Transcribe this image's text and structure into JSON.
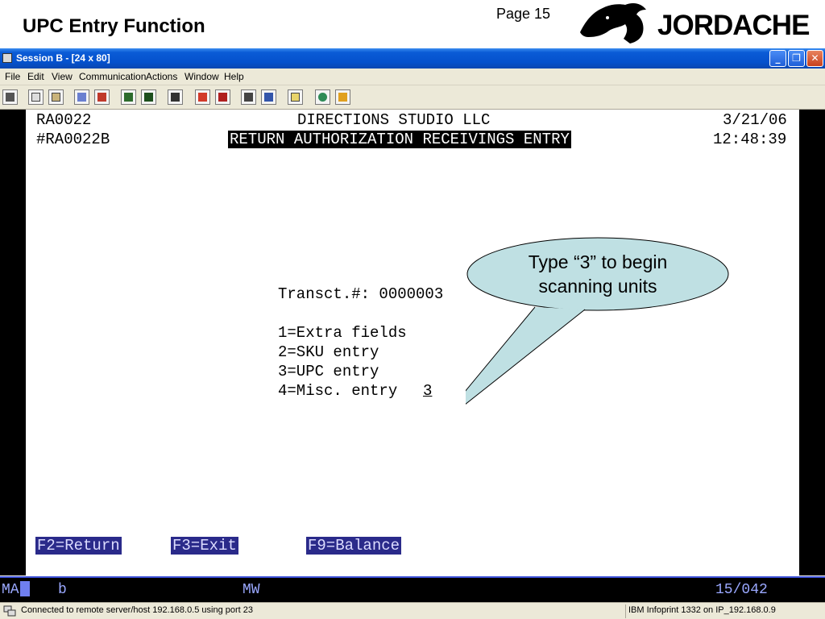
{
  "slide": {
    "title": "UPC Entry Function",
    "page": "Page 15",
    "logo_text": "JORDACHE"
  },
  "window": {
    "title": "Session B - [24 x 80]",
    "controls": {
      "minimize": "_",
      "restore": "❐",
      "close": "✕"
    }
  },
  "menu": [
    "File",
    "Edit",
    "View",
    "Communication",
    "Actions",
    "Window",
    "Help"
  ],
  "toolbar_icons": [
    "print-screen-icon",
    "copy-icon",
    "paste-icon",
    "send-file-icon",
    "receive-file-icon",
    "display-icon",
    "keypad-icon",
    "macro-icon",
    "record-macro-icon",
    "stop-macro-icon",
    "play-macro-icon",
    "play-macro-2-icon",
    "clipboard-icon",
    "globe-icon",
    "help-icon"
  ],
  "terminal": {
    "program": "RA0022",
    "company": "DIRECTIONS STUDIO LLC",
    "date": "3/21/06",
    "screen_id": "#RA0022B",
    "screen_title": "RETURN AUTHORIZATION RECEIVINGS ENTRY",
    "time": "12:48:39",
    "transaction": "Transct.#: 0000003",
    "options": [
      "1=Extra fields",
      "2=SKU entry",
      "3=UPC entry",
      "4=Misc. entry"
    ],
    "selection": "3",
    "function_keys": [
      "F2=Return",
      "F3=Exit",
      "F9=Balance"
    ]
  },
  "oia": {
    "mode": "MA",
    "indicator": "b",
    "mw": "MW",
    "position": "15/042"
  },
  "statusbar": {
    "connection": "Connected to remote server/host 192.168.0.5 using port 23",
    "printer": "IBM Infoprint 1332 on IP_192.168.0.9"
  },
  "callout": {
    "line1": "Type “3” to begin",
    "line2": "scanning units"
  },
  "colors": {
    "titlebar": "#0551cc",
    "callout_fill": "#bfe0e3",
    "fkey_bg": "#2a2a8a",
    "oia_text": "#9aa8ff"
  }
}
